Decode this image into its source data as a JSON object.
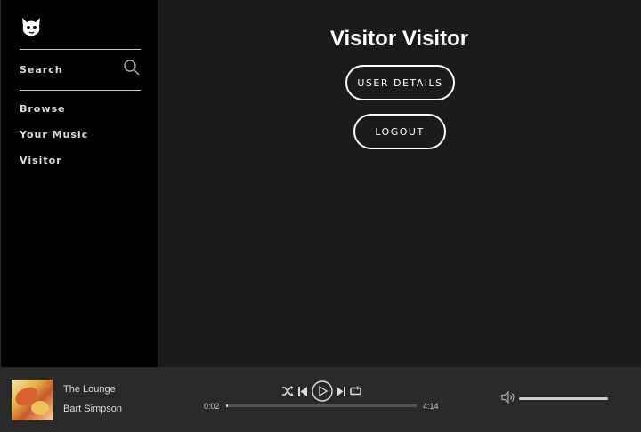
{
  "sidebar": {
    "logo_icon": "cat-logo-icon",
    "search_label": "Search",
    "search_icon": "search-icon",
    "items": [
      {
        "label": "Browse"
      },
      {
        "label": "Your Music"
      },
      {
        "label": "Visitor"
      }
    ]
  },
  "main": {
    "title": "Visitor Visitor",
    "user_details_label": "USER DETAILS",
    "logout_label": "LOGOUT"
  },
  "player": {
    "track_title": "The Lounge",
    "artist": "Bart Simpson",
    "current_time": "0:02",
    "total_time": "4:14",
    "progress_fraction": 0.008,
    "volume_fraction": 1.0,
    "controls": [
      "shuffle-icon",
      "previous-icon",
      "play-icon",
      "next-icon",
      "repeat-icon"
    ],
    "volume_icon": "volume-icon"
  },
  "colors": {
    "sidebar_bg": "#000000",
    "main_bg": "#1b1b1b",
    "player_bg": "#2a2a2a",
    "text": "#ffffff"
  }
}
